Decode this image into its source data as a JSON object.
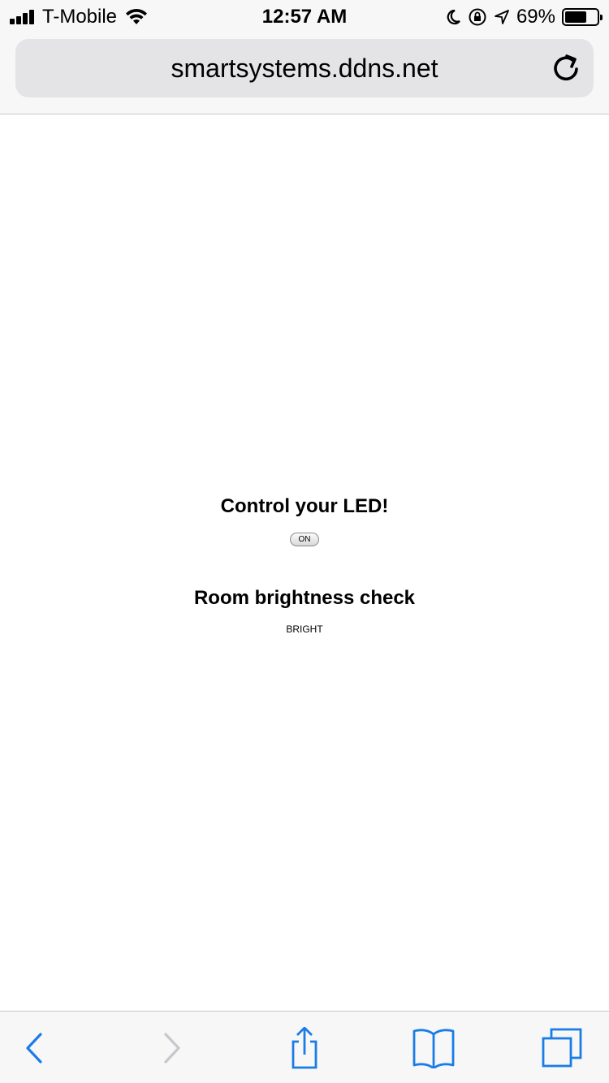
{
  "status_bar": {
    "carrier": "T-Mobile",
    "time": "12:57 AM",
    "battery_percent": "69%",
    "battery_level": 0.69,
    "icons": [
      "signal-bars-icon",
      "wifi-icon",
      "moon-icon",
      "rotation-lock-icon",
      "location-arrow-icon",
      "battery-icon"
    ]
  },
  "browser": {
    "url": "smartsystems.ddns.net",
    "accent_color": "#1a7ce6",
    "disabled_color": "#c7c7cc",
    "toolbar_icons": [
      "back-icon",
      "forward-icon",
      "share-icon",
      "bookmarks-icon",
      "tabs-icon"
    ]
  },
  "page": {
    "led_heading": "Control your LED!",
    "led_button_label": "ON",
    "room_heading": "Room brightness check",
    "room_status": "BRIGHT"
  }
}
